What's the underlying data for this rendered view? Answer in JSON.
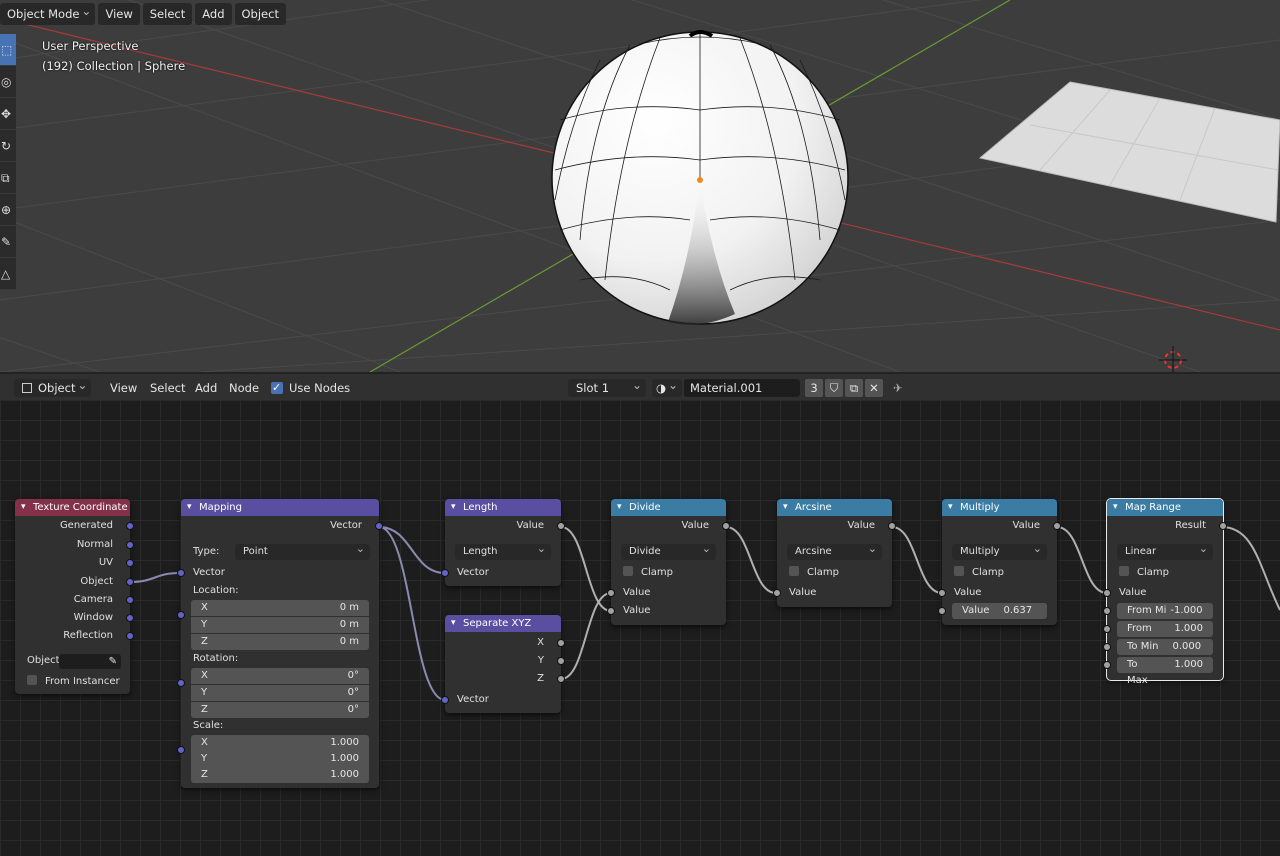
{
  "viewport": {
    "header": {
      "mode": "Object Mode",
      "menus": [
        "View",
        "Select",
        "Add",
        "Object"
      ]
    },
    "info": {
      "perspective": "User Perspective",
      "collection": "(192) Collection | Sphere"
    },
    "tools": [
      "select-box",
      "cursor",
      "move",
      "rotate",
      "scale",
      "transform",
      "annotate",
      "measure"
    ]
  },
  "node_header": {
    "editor_type": "Object",
    "menus": [
      "View",
      "Select",
      "Add",
      "Node"
    ],
    "use_nodes_label": "Use Nodes",
    "use_nodes": true,
    "slot": "Slot 1",
    "material": "Material.001",
    "user_count": "3"
  },
  "nodes": {
    "texture_coordinate": {
      "title": "Texture Coordinate",
      "outputs": [
        "Generated",
        "Normal",
        "UV",
        "Object",
        "Camera",
        "Window",
        "Reflection"
      ],
      "object_label": "Object",
      "from_instancer": "From Instancer"
    },
    "mapping": {
      "title": "Mapping",
      "output": "Vector",
      "type_label": "Type:",
      "type_value": "Point",
      "input": "Vector",
      "location_label": "Location:",
      "location": {
        "x": "0 m",
        "y": "0 m",
        "z": "0 m"
      },
      "rotation_label": "Rotation:",
      "rotation": {
        "x": "0°",
        "y": "0°",
        "z": "0°"
      },
      "scale_label": "Scale:",
      "scale": {
        "x": "1.000",
        "y": "1.000",
        "z": "1.000"
      },
      "axis": {
        "x": "X",
        "y": "Y",
        "z": "Z"
      }
    },
    "length": {
      "title": "Length",
      "output": "Value",
      "operation": "Length",
      "input": "Vector"
    },
    "separate_xyz": {
      "title": "Separate XYZ",
      "outputs": [
        "X",
        "Y",
        "Z"
      ],
      "input": "Vector"
    },
    "divide": {
      "title": "Divide",
      "output": "Value",
      "operation": "Divide",
      "clamp": "Clamp",
      "inputs": [
        "Value",
        "Value"
      ]
    },
    "arcsine": {
      "title": "Arcsine",
      "output": "Value",
      "operation": "Arcsine",
      "clamp": "Clamp",
      "input": "Value"
    },
    "multiply": {
      "title": "Multiply",
      "output": "Value",
      "operation": "Multiply",
      "clamp": "Clamp",
      "input": "Value",
      "value_label": "Value",
      "value": "0.637"
    },
    "map_range": {
      "title": "Map Range",
      "output": "Result",
      "interpolation": "Linear",
      "clamp": "Clamp",
      "input": "Value",
      "fields": [
        {
          "label": "From Mi",
          "value": "-1.000"
        },
        {
          "label": "From Ma",
          "value": "1.000"
        },
        {
          "label": "To Min",
          "value": "0.000"
        },
        {
          "label": "To Max",
          "value": "1.000"
        }
      ]
    }
  },
  "colors": {
    "input_header": "#83314a",
    "vector_header": "#5a4ea1",
    "converter_header": "#3b7ca4",
    "vector_socket": "#6363c7",
    "value_socket": "#a1a1a1",
    "accent": "#4772b3"
  }
}
